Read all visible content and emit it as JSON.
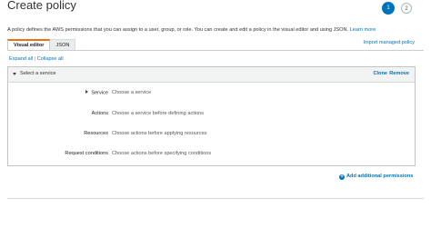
{
  "page": {
    "title": "Create policy",
    "steps": [
      "1",
      "2"
    ],
    "description_prefix": "A policy defines the AWS permissions that you can assign to a user, group, or role. You can create and edit a policy in the visual editor and using JSON.",
    "learn_more": "Learn more"
  },
  "tabs": [
    {
      "label": "Visual editor",
      "active": true
    },
    {
      "label": "JSON",
      "active": false
    }
  ],
  "import_label": "Import managed policy",
  "expand_all": "Expand all",
  "expand_sep": "|",
  "collapse_all": "Collapse all",
  "panel": {
    "title": "Select a service",
    "clone": "Clone",
    "remove": "Remove",
    "rows": [
      {
        "label": "Service",
        "value": "Choose a service"
      },
      {
        "label": "Actions",
        "value": "Choose a service before defining actions"
      },
      {
        "label": "Resources",
        "value": "Choose actions before applying resources"
      },
      {
        "label": "Request conditions",
        "value": "Choose actions before specifying conditions"
      }
    ]
  },
  "add_permissions": "Add additional permissions",
  "colors": {
    "accent": "#0073bb",
    "tab_highlight": "#ec7211"
  },
  "icons": [
    "caret-down-icon",
    "caret-right-icon",
    "plus-circle-icon"
  ]
}
